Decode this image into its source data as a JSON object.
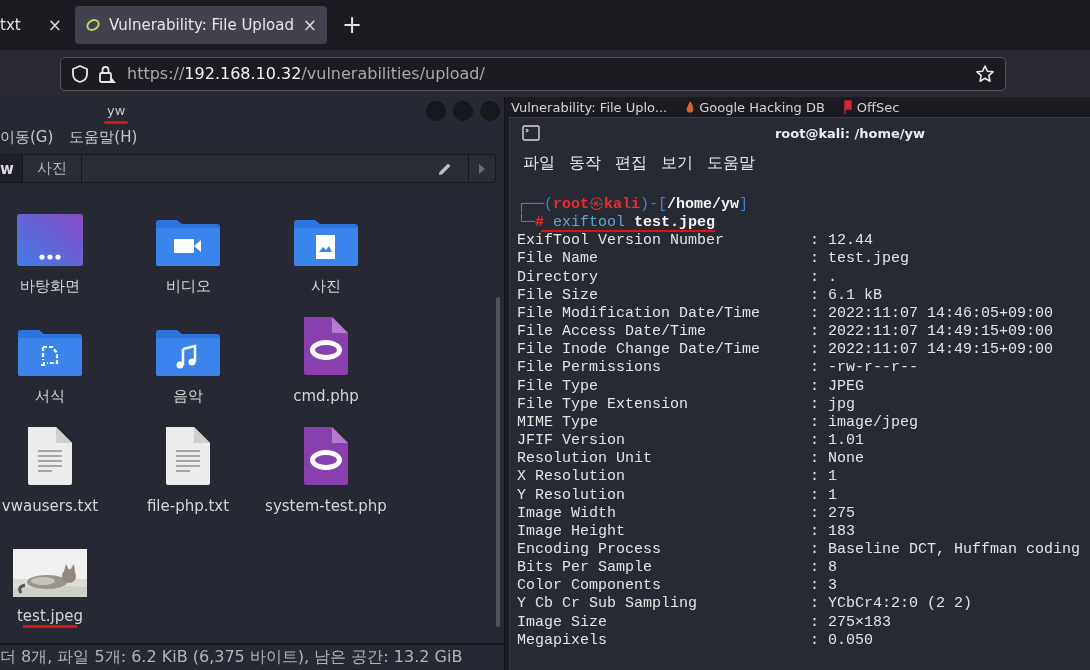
{
  "browser": {
    "tabs": [
      {
        "title": "txt",
        "close": "×",
        "selected": false
      },
      {
        "title": "Vulnerability: File Upload",
        "close": "×",
        "selected": true
      }
    ],
    "new_tab": "+",
    "url": {
      "scheme": "https://",
      "host": "192.168.10.32",
      "path": "/vulnerabilities/upload/"
    },
    "bookmarks": [
      {
        "label": "Vulnerability: File Uplo...",
        "kind": "page"
      },
      {
        "label": "Google Hacking DB",
        "kind": "flame"
      },
      {
        "label": "OffSec",
        "kind": "flag"
      }
    ]
  },
  "file_manager": {
    "title": "yw",
    "title_underlined": true,
    "menu": [
      "이동(G)",
      "도움말(H)"
    ],
    "path": [
      {
        "label": "w",
        "selected": true
      },
      {
        "label": "사진",
        "selected": false
      }
    ],
    "items": [
      {
        "label": "바탕화면",
        "kind": "desktop",
        "underlined": false
      },
      {
        "label": "비디오",
        "kind": "video-folder",
        "underlined": false
      },
      {
        "label": "사진",
        "kind": "picture-folder",
        "underlined": false
      },
      {
        "label": "서식",
        "kind": "template-folder",
        "underlined": false
      },
      {
        "label": "음악",
        "kind": "music-folder",
        "underlined": false
      },
      {
        "label": "cmd.php",
        "kind": "script",
        "underlined": false
      },
      {
        "label": "vwausers.txt",
        "kind": "text",
        "underlined": false
      },
      {
        "label": "file-php.txt",
        "kind": "text",
        "underlined": false
      },
      {
        "label": "system-test.php",
        "kind": "script",
        "underlined": false
      },
      {
        "label": "test.jpeg",
        "kind": "picture",
        "underlined": true
      }
    ],
    "status": "더 8개, 파일 5개: 6.2 KiB (6,375 바이트), 남은 공간: 13.2 GiB"
  },
  "terminal": {
    "title": "root@kali: /home/yw",
    "menu": [
      "파일",
      "동작",
      "편집",
      "보기",
      "도움말"
    ],
    "prompt": {
      "open": "┌──(",
      "user": "root",
      "at": "㉿",
      "host": "kali",
      "mid": ")-[",
      "path": "/home/yw",
      "close": "]",
      "corner": "└─",
      "hash": "#"
    },
    "command": {
      "tool": "exiftool",
      "arg": "test.jpeg",
      "underlined": true
    },
    "rows": [
      {
        "key": "ExifTool Version Number",
        "value": ": 12.44"
      },
      {
        "key": "File Name",
        "value": ": test.jpeg"
      },
      {
        "key": "Directory",
        "value": ": ."
      },
      {
        "key": "File Size",
        "value": ": 6.1 kB"
      },
      {
        "key": "File Modification Date/Time",
        "value": ": 2022:11:07 14:46:05+09:00"
      },
      {
        "key": "File Access Date/Time",
        "value": ": 2022:11:07 14:49:15+09:00"
      },
      {
        "key": "File Inode Change Date/Time",
        "value": ": 2022:11:07 14:49:15+09:00"
      },
      {
        "key": "File Permissions",
        "value": ": -rw-r--r--"
      },
      {
        "key": "File Type",
        "value": ": JPEG"
      },
      {
        "key": "File Type Extension",
        "value": ": jpg"
      },
      {
        "key": "MIME Type",
        "value": ": image/jpeg"
      },
      {
        "key": "JFIF Version",
        "value": ": 1.01"
      },
      {
        "key": "Resolution Unit",
        "value": ": None"
      },
      {
        "key": "X Resolution",
        "value": ": 1"
      },
      {
        "key": "Y Resolution",
        "value": ": 1"
      },
      {
        "key": "Image Width",
        "value": ": 275"
      },
      {
        "key": "Image Height",
        "value": ": 183"
      },
      {
        "key": "Encoding Process",
        "value": ": Baseline DCT, Huffman coding"
      },
      {
        "key": "Bits Per Sample",
        "value": ": 8"
      },
      {
        "key": "Color Components",
        "value": ": 3"
      },
      {
        "key": "Y Cb Cr Sub Sampling",
        "value": ": YCbCr4:2:0 (2 2)"
      },
      {
        "key": "Image Size",
        "value": ": 275×183"
      },
      {
        "key": "Megapixels",
        "value": ": 0.050"
      }
    ]
  }
}
